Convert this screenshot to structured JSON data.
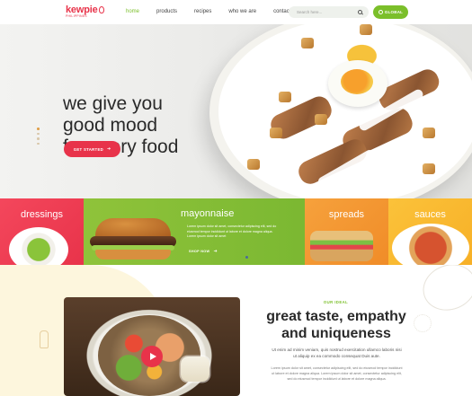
{
  "header": {
    "logo": "kewpie",
    "logo_sub": "PHILIPPINES",
    "nav": [
      "home",
      "products",
      "recipes",
      "who we are",
      "contact us"
    ],
    "search_placeholder": "Search here...",
    "global_label": "GLOBAL"
  },
  "hero": {
    "title": "we give you\ngood mood\nfor every food",
    "cta_label": "GET STARTED"
  },
  "categories": {
    "dressings": "dressings",
    "mayonnaise": "mayonnaise",
    "mayo_text": "Lorem ipsum dolor sit amet, consectetur adipiscing elit, sed do eiusmod tempor incididunt ut labore et dolore magna aliqua. Lorem ipsum dolor sit amet",
    "shop_now": "SHOP NOW",
    "spreads": "spreads",
    "sauces": "sauces"
  },
  "about": {
    "label": "OUR IDEAL",
    "title": "great taste, empathy and uniqueness",
    "lead": "Ut enim ad minim veniam, quis nostrud exercitation ullamco laboris nisi ut aliquip ex ea commodo consequat Duis aute.",
    "body": "Lorem ipsum dolor sit amet, consectetur adipiscing elit, sed do eiusmod tempor incididunt ut labore et dolore magna aliqua. Lorem ipsum dolor sit amet, consectetur adipiscing elit, sed do eiusmod tempor incididunt ut labore et dolore magna aliqua."
  },
  "colors": {
    "brand_red": "#e8334a",
    "brand_green": "#7bbf2a",
    "spreads_orange": "#f08c28",
    "sauces_yellow": "#f7b027"
  }
}
